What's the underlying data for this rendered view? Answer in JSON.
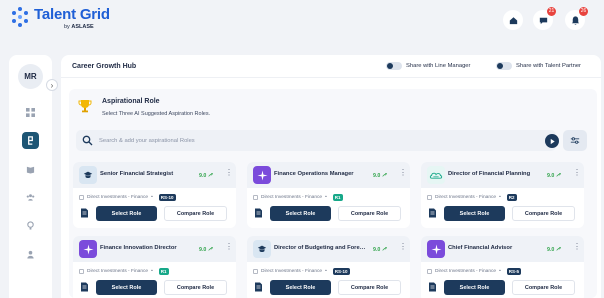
{
  "brand": {
    "title": "Talent Grid",
    "by": "by",
    "company": "ASLASE",
    "color": "#1f5fd6"
  },
  "topbar": {
    "icons": [
      {
        "name": "home-icon"
      },
      {
        "name": "chat-icon",
        "badge": "21"
      },
      {
        "name": "bell-icon",
        "badge": "26"
      }
    ]
  },
  "sidebar": {
    "avatar_initials": "MR",
    "items": [
      {
        "name": "dashboard-icon",
        "active": false
      },
      {
        "name": "career-icon",
        "active": true
      },
      {
        "name": "book-icon",
        "active": false
      },
      {
        "name": "team-icon",
        "active": false
      },
      {
        "name": "ideas-icon",
        "active": false
      },
      {
        "name": "profile-icon",
        "active": false
      }
    ]
  },
  "header": {
    "title": "Career Growth Hub",
    "share_manager": "Share with Line Manager",
    "share_partner": "Share with Talent Partner"
  },
  "aspiration": {
    "title": "Aspirational Role",
    "subtitle": "Select Three  AI Suggested Aspiration Roles.",
    "search_placeholder": "Search & add your aspirational Roles"
  },
  "cards": [
    {
      "title": "Senior Financial Strategist",
      "score": "9.0",
      "meta": "Direct Investments - Finance",
      "level": "RS-10",
      "level_color": "navy",
      "icon": "graduation-cap-icon",
      "icon_bg": "#d9e6f2"
    },
    {
      "title": "Finance Operations Manager",
      "score": "9.0",
      "meta": "Direct Investments - Finance",
      "level": "R1",
      "level_color": "green",
      "icon": "sparkle-icon",
      "icon_bg": "#7b4bdb"
    },
    {
      "title": "Director of Financial Planning",
      "score": "9.0",
      "meta": "Direct Investments - Finance",
      "level": "R2",
      "level_color": "navy",
      "icon": "cloud-logo-icon",
      "icon_bg": "#e6f6f4"
    },
    {
      "title": "Finance Innovation Director",
      "score": "9.0",
      "meta": "Direct Investments - Finance",
      "level": "R1",
      "level_color": "green",
      "icon": "sparkle-icon",
      "icon_bg": "#7b4bdb"
    },
    {
      "title": "Director of Budgeting and Forecasting",
      "score": "9.0",
      "meta": "Direct Investments - Finance",
      "level": "RS-10",
      "level_color": "navy",
      "icon": "graduation-cap-icon",
      "icon_bg": "#d9e6f2"
    },
    {
      "title": "Chief Financial Advisor",
      "score": "9.0",
      "meta": "Direct Investments - Finance",
      "level": "RS-5",
      "level_color": "navy",
      "icon": "sparkle-icon",
      "icon_bg": "#7b4bdb"
    }
  ],
  "buttons": {
    "select": "Select Role",
    "compare": "Compare Role"
  }
}
